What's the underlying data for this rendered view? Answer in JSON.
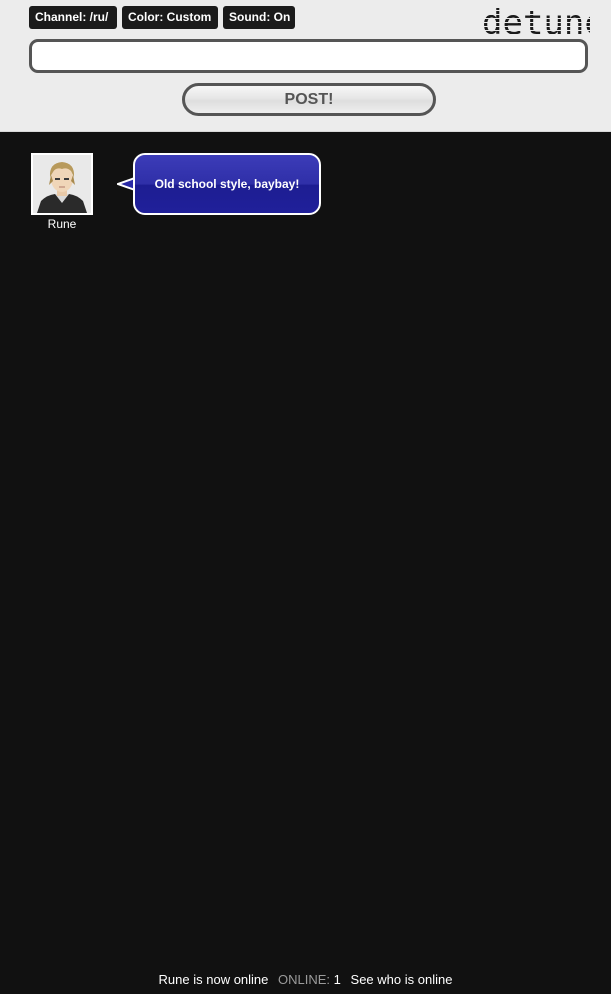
{
  "header": {
    "channel_label": "Channel: /ru/",
    "color_label": "Color: Custom",
    "sound_label": "Sound: On",
    "logo_text": "detune"
  },
  "composer": {
    "input_value": "",
    "input_placeholder": "",
    "post_button_label": "POST!"
  },
  "messages": [
    {
      "author": "Rune",
      "avatar_icon": "anime-avatar-icon",
      "text": "Old school style, baybay!",
      "bubble_color": "#2424a0"
    }
  ],
  "footer": {
    "status_text": "Rune is now online",
    "online_label": "ONLINE:",
    "online_count": "1",
    "who_link": "See who is online"
  },
  "colors": {
    "header_bg": "#ececec",
    "page_bg": "#111111",
    "pill_bg": "#1b1b1b",
    "border_gray": "#555555"
  }
}
